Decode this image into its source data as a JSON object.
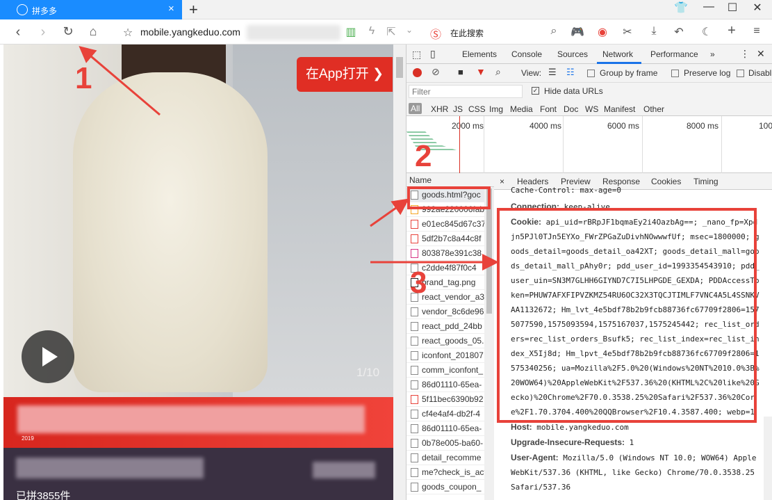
{
  "browser": {
    "tab_title": "拼多多",
    "new_tab": "+",
    "url": "mobile.yangkeduo.com",
    "search_placeholder": "在此搜索"
  },
  "page": {
    "app_button": "在App打开",
    "counter": "1/10",
    "promo_year": "2019",
    "sold": "已拼3855件"
  },
  "devtools": {
    "tabs": [
      "Elements",
      "Console",
      "Sources",
      "Network",
      "Performance",
      "»"
    ],
    "active_tab": "Network",
    "toolbar": {
      "view": "View:",
      "group_by_frame": "Group by frame",
      "preserve_log": "Preserve log",
      "disable": "Disabl"
    },
    "filter": {
      "placeholder": "Filter",
      "hide_data_urls": "Hide data URLs"
    },
    "types": [
      "All",
      "XHR",
      "JS",
      "CSS",
      "Img",
      "Media",
      "Font",
      "Doc",
      "WS",
      "Manifest",
      "Other"
    ],
    "timeline_labels": [
      "2000 ms",
      "4000 ms",
      "6000 ms",
      "8000 ms",
      "100"
    ],
    "name_header": "Name",
    "requests": [
      "goods.html?goc",
      "992ae220006fab",
      "e01ec845d67c37",
      "5df2b7c8a44c8f",
      "803878e391c38",
      "c2dde4f87f0c4",
      "brand_tag.png",
      "react_vendor_a3",
      "vendor_8c6de96",
      "react_pdd_24bb",
      "react_goods_05.",
      "iconfont_201807",
      "comm_iconfont_",
      "86d01110-65ea-",
      "5f11bec6390b92",
      "cf4e4af4-db2f-4",
      "86d01110-65ea-",
      "0b78e005-ba60-",
      "detail_recomme",
      "me?check_is_act",
      "goods_coupon_"
    ],
    "detail_tabs": [
      "×",
      "Headers",
      "Preview",
      "Response",
      "Cookies",
      "Timing"
    ],
    "headers": {
      "cache_control": "Cache-Control: max-age=0",
      "connection_name": "Connection:",
      "connection_value": "keep-alive",
      "cookie_name": "Cookie:",
      "cookie_value": "api_uid=rBRpJF1bqmaEy2i4OazbAg==; _nano_fp=Xpdjn5PJl0TJn5EYXo_FWrZPGaZuDivhNOwwwfUf; msec=1800000; goods_detail=goods_detail_oa42XT; goods_detail_mall=goods_detail_mall_pAhy0r; pdd_user_id=1993354543910; pdd_user_uin=SN3M7GLHH6GIYND7C7I5LHPGDE_GEXDA; PDDAccessToken=PHUW7AFXFIPVZKMZ54RU6OC32X3TQCJTIMLF7VNC4A5L4SSNKVAA1132672; Hm_lvt_4e5bdf78b2b9fcb88736fc67709f2806=1575077590,1575093594,1575167037,1575245442; rec_list_orders=rec_list_orders_Bsufk5; rec_list_index=rec_list_index_X5Ij8d; Hm_lpvt_4e5bdf78b2b9fcb88736fc67709f2806=1575340256; ua=Mozilla%2F5.0%20(Windows%20NT%2010.0%3B%20WOW64)%20AppleWebKit%2F537.36%20(KHTML%2C%20like%20Gecko)%20Chrome%2F70.0.3538.25%20Safari%2F537.36%20Core%2F1.70.3704.400%20QQBrowser%2F10.4.3587.400; webp=1",
      "host_name": "Host:",
      "host_value": "mobile.yangkeduo.com",
      "uir_name": "Upgrade-Insecure-Requests:",
      "uir_value": "1",
      "ua_name": "User-Agent:",
      "ua_value": "Mozilla/5.0 (Windows NT 10.0; WOW64) AppleWebKit/537.36 (KHTML, like Gecko) Chrome/70.0.3538.25 Safari/537.36"
    }
  },
  "annotations": {
    "one": "1",
    "two": "2",
    "three": "3"
  },
  "colors": {
    "accent": "#1a8cff",
    "annotation": "#e8423a",
    "pdd_red": "#e02e24"
  }
}
